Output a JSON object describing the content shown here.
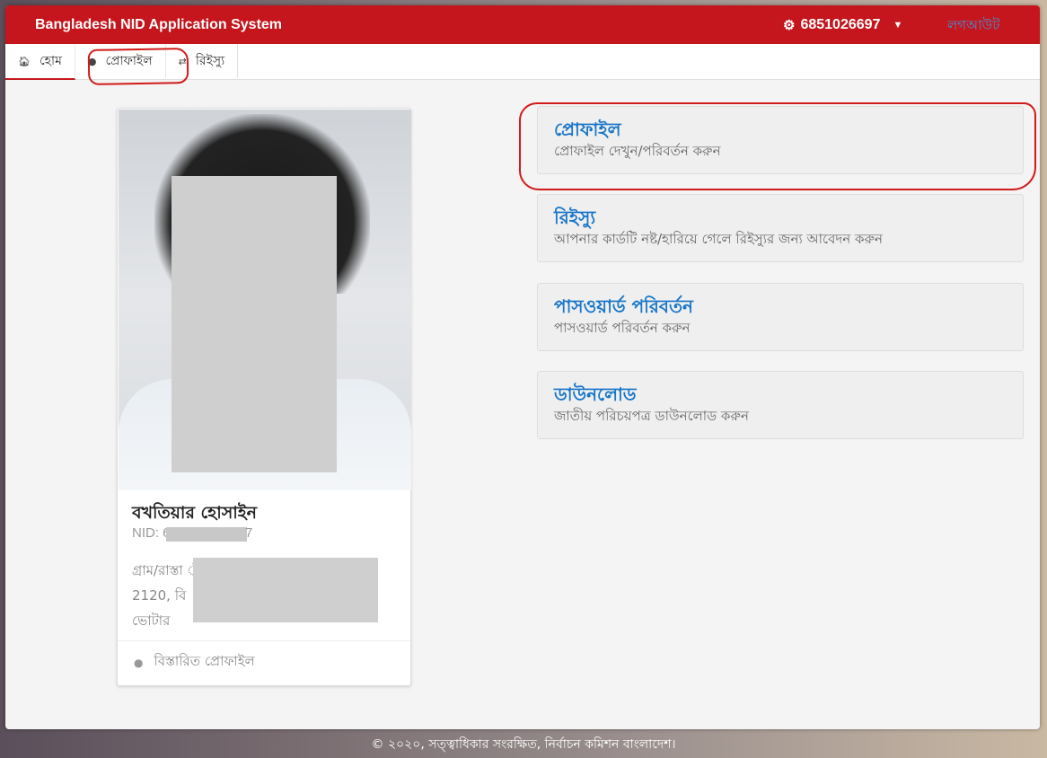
{
  "topbar": {
    "brand": "Bangladesh NID Application System",
    "user_id": "6851026697",
    "logout_label": "লগআউট",
    "bg_color": "#c4161c"
  },
  "nav": {
    "items": [
      {
        "icon": "home-icon",
        "label": "হোম"
      },
      {
        "icon": "user-icon",
        "label": "প্রোফাইল"
      },
      {
        "icon": "refresh-icon",
        "label": "রিইস্যু"
      }
    ]
  },
  "profile": {
    "name": "বখতিয়ার হোসাইন",
    "nid_label": "NID: 6",
    "nid_suffix": "7",
    "address_line1": "গ্রাম/রাস্তা                              ী -",
    "address_line2": "2120, বি",
    "address_line3": "ভোটার",
    "detail_link": "বিস্তারিত প্রোফাইল"
  },
  "menu": [
    {
      "title": "প্রোফাইল",
      "subtitle": "প্রোফাইল দেখুন/পরিবর্তন করুন"
    },
    {
      "title": "রিইস্যু",
      "subtitle": "আপনার কার্ডটি নষ্ট/হারিয়ে গেলে রিইস্যুর জন্য আবেদন করুন"
    },
    {
      "title": "পাসওয়ার্ড পরিবর্তন",
      "subtitle": "পাসওয়ার্ড পরিবর্তন করুন"
    },
    {
      "title": "ডাউনলোড",
      "subtitle": "জাতীয় পরিচয়পত্র ডাউনলোড করুন"
    }
  ],
  "footer": "© ২০২০, সত্ত্বাধিকার সংরক্ষিত, নির্বাচন কমিশন বাংলাদেশ।"
}
